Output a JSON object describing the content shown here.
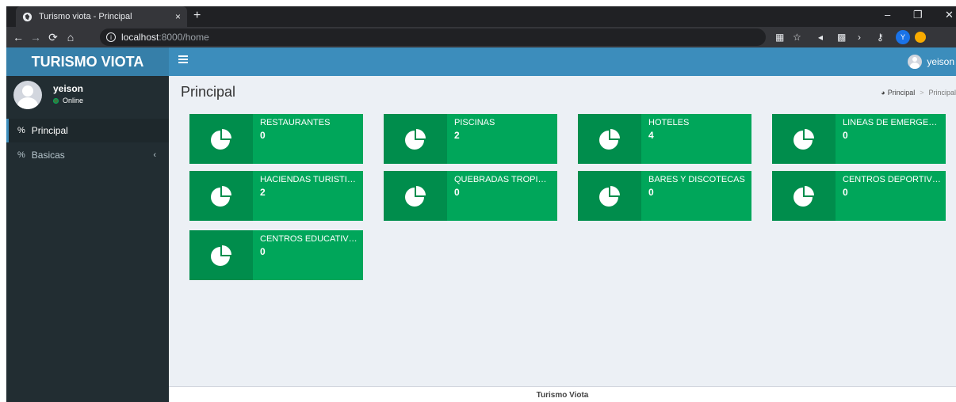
{
  "browser": {
    "tab_title": "Turismo viota - Principal",
    "tab_close": "×",
    "new_tab": "+",
    "url_host": "localhost",
    "url_rest": ":8000/home",
    "profile_initial": "Y"
  },
  "header": {
    "logo": "TURISMO VIOTA",
    "user_name": "yeison"
  },
  "sidebar": {
    "user_name": "yeison",
    "status": "Online",
    "items": [
      {
        "label": "Principal"
      },
      {
        "label": "Basicas"
      }
    ]
  },
  "main": {
    "title": "Principal",
    "breadcrumb": [
      "Principal",
      "Principal"
    ],
    "boxes": [
      {
        "label": "RESTAURANTES",
        "value": "0"
      },
      {
        "label": "PISCINAS",
        "value": "2"
      },
      {
        "label": "HOTELES",
        "value": "4"
      },
      {
        "label": "LINEAS DE EMERGENCIA",
        "value": "0"
      },
      {
        "label": "HACIENDAS TURISTICAS",
        "value": "2"
      },
      {
        "label": "QUEBRADAS TROPICALES",
        "value": "0"
      },
      {
        "label": "BARES Y DISCOTECAS",
        "value": "0"
      },
      {
        "label": "CENTROS DEPORTIVOS",
        "value": "0"
      },
      {
        "label": "CENTROS EDUCATIVOS",
        "value": "0"
      }
    ]
  },
  "footer": {
    "text": "Turismo Viota"
  },
  "colors": {
    "box_bg": "#00a65a",
    "box_icon_bg": "#008d4c",
    "header_bg": "#3c8dbc",
    "logo_bg": "#367fa9",
    "sidebar_bg": "#222d32"
  }
}
